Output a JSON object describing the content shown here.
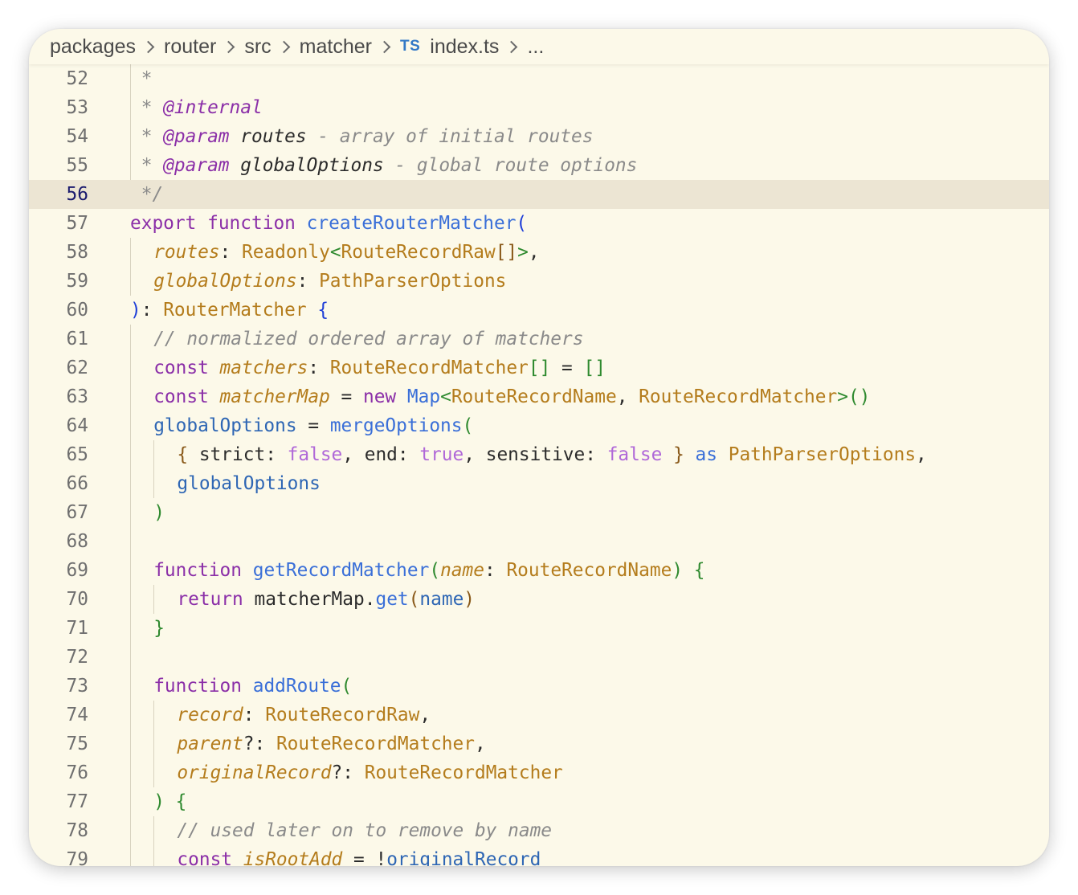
{
  "breadcrumb": {
    "items": [
      "packages",
      "router",
      "src",
      "matcher"
    ],
    "file_icon": "TS",
    "file": "index.ts",
    "more": "..."
  },
  "editor": {
    "current_line": 56,
    "lines": [
      {
        "n": "52",
        "indent": 0,
        "guides": [
          0
        ],
        "tokens": [
          {
            "t": " *",
            "c": "cmt"
          }
        ]
      },
      {
        "n": "53",
        "indent": 0,
        "guides": [
          0
        ],
        "tokens": [
          {
            "t": " * ",
            "c": "cmt"
          },
          {
            "t": "@internal",
            "c": "tag"
          }
        ]
      },
      {
        "n": "54",
        "indent": 0,
        "guides": [
          0
        ],
        "tokens": [
          {
            "t": " * ",
            "c": "cmt"
          },
          {
            "t": "@param",
            "c": "tag"
          },
          {
            "t": " routes",
            "c": "cmtname"
          },
          {
            "t": " - array of initial routes",
            "c": "cmt"
          }
        ]
      },
      {
        "n": "55",
        "indent": 0,
        "guides": [
          0
        ],
        "tokens": [
          {
            "t": " * ",
            "c": "cmt"
          },
          {
            "t": "@param",
            "c": "tag"
          },
          {
            "t": " globalOptions",
            "c": "cmtname"
          },
          {
            "t": " - global route options",
            "c": "cmt"
          }
        ]
      },
      {
        "n": "56",
        "indent": 0,
        "guides": [],
        "tokens": [
          {
            "t": " */",
            "c": "cmt"
          }
        ]
      },
      {
        "n": "57",
        "indent": 0,
        "guides": [],
        "tokens": [
          {
            "t": "export",
            "c": "kw"
          },
          {
            "t": " ",
            "c": "plain"
          },
          {
            "t": "function",
            "c": "kw"
          },
          {
            "t": " ",
            "c": "plain"
          },
          {
            "t": "createRouterMatcher",
            "c": "fn"
          },
          {
            "t": "(",
            "c": "brk1"
          }
        ]
      },
      {
        "n": "58",
        "indent": 1,
        "guides": [
          0
        ],
        "tokens": [
          {
            "t": "routes",
            "c": "param"
          },
          {
            "t": ": ",
            "c": "punc"
          },
          {
            "t": "Readonly",
            "c": "type"
          },
          {
            "t": "<",
            "c": "brk2"
          },
          {
            "t": "RouteRecordRaw",
            "c": "type"
          },
          {
            "t": "[]",
            "c": "brk3"
          },
          {
            "t": ">",
            "c": "brk2"
          },
          {
            "t": ",",
            "c": "punc"
          }
        ]
      },
      {
        "n": "59",
        "indent": 1,
        "guides": [
          0
        ],
        "tokens": [
          {
            "t": "globalOptions",
            "c": "param"
          },
          {
            "t": ": ",
            "c": "punc"
          },
          {
            "t": "PathParserOptions",
            "c": "type"
          }
        ]
      },
      {
        "n": "60",
        "indent": 0,
        "guides": [],
        "tokens": [
          {
            "t": ")",
            "c": "brk1"
          },
          {
            "t": ": ",
            "c": "punc"
          },
          {
            "t": "RouterMatcher",
            "c": "type"
          },
          {
            "t": " ",
            "c": "plain"
          },
          {
            "t": "{",
            "c": "brk1"
          }
        ]
      },
      {
        "n": "61",
        "indent": 1,
        "guides": [
          0
        ],
        "tokens": [
          {
            "t": "// normalized ordered array of matchers",
            "c": "cmt"
          }
        ]
      },
      {
        "n": "62",
        "indent": 1,
        "guides": [
          0
        ],
        "tokens": [
          {
            "t": "const",
            "c": "kw"
          },
          {
            "t": " ",
            "c": "plain"
          },
          {
            "t": "matchers",
            "c": "param"
          },
          {
            "t": ": ",
            "c": "punc"
          },
          {
            "t": "RouteRecordMatcher",
            "c": "type"
          },
          {
            "t": "[]",
            "c": "brk2"
          },
          {
            "t": " = ",
            "c": "punc"
          },
          {
            "t": "[]",
            "c": "brk2"
          }
        ]
      },
      {
        "n": "63",
        "indent": 1,
        "guides": [
          0
        ],
        "tokens": [
          {
            "t": "const",
            "c": "kw"
          },
          {
            "t": " ",
            "c": "plain"
          },
          {
            "t": "matcherMap",
            "c": "param"
          },
          {
            "t": " = ",
            "c": "punc"
          },
          {
            "t": "new",
            "c": "kw"
          },
          {
            "t": " ",
            "c": "plain"
          },
          {
            "t": "Map",
            "c": "fn"
          },
          {
            "t": "<",
            "c": "brk2"
          },
          {
            "t": "RouteRecordName",
            "c": "type"
          },
          {
            "t": ", ",
            "c": "punc"
          },
          {
            "t": "RouteRecordMatcher",
            "c": "type"
          },
          {
            "t": ">",
            "c": "brk2"
          },
          {
            "t": "()",
            "c": "brk2"
          }
        ]
      },
      {
        "n": "64",
        "indent": 1,
        "guides": [
          0
        ],
        "tokens": [
          {
            "t": "globalOptions",
            "c": "var"
          },
          {
            "t": " = ",
            "c": "punc"
          },
          {
            "t": "mergeOptions",
            "c": "fn"
          },
          {
            "t": "(",
            "c": "brk2"
          }
        ]
      },
      {
        "n": "65",
        "indent": 2,
        "guides": [
          0,
          1
        ],
        "tokens": [
          {
            "t": "{",
            "c": "brk3"
          },
          {
            "t": " strict: ",
            "c": "plain"
          },
          {
            "t": "false",
            "c": "bool"
          },
          {
            "t": ", end: ",
            "c": "plain"
          },
          {
            "t": "true",
            "c": "bool"
          },
          {
            "t": ", sensitive: ",
            "c": "plain"
          },
          {
            "t": "false",
            "c": "bool"
          },
          {
            "t": " ",
            "c": "plain"
          },
          {
            "t": "}",
            "c": "brk3"
          },
          {
            "t": " ",
            "c": "plain"
          },
          {
            "t": "as",
            "c": "fn"
          },
          {
            "t": " ",
            "c": "plain"
          },
          {
            "t": "PathParserOptions",
            "c": "type"
          },
          {
            "t": ",",
            "c": "punc"
          }
        ]
      },
      {
        "n": "66",
        "indent": 2,
        "guides": [
          0,
          1
        ],
        "tokens": [
          {
            "t": "globalOptions",
            "c": "var"
          }
        ]
      },
      {
        "n": "67",
        "indent": 1,
        "guides": [
          0
        ],
        "tokens": [
          {
            "t": ")",
            "c": "brk2"
          }
        ]
      },
      {
        "n": "68",
        "indent": 0,
        "guides": [
          0
        ],
        "tokens": []
      },
      {
        "n": "69",
        "indent": 1,
        "guides": [
          0
        ],
        "tokens": [
          {
            "t": "function",
            "c": "kw"
          },
          {
            "t": " ",
            "c": "plain"
          },
          {
            "t": "getRecordMatcher",
            "c": "fn"
          },
          {
            "t": "(",
            "c": "brk2"
          },
          {
            "t": "name",
            "c": "param"
          },
          {
            "t": ": ",
            "c": "punc"
          },
          {
            "t": "RouteRecordName",
            "c": "type"
          },
          {
            "t": ")",
            "c": "brk2"
          },
          {
            "t": " ",
            "c": "plain"
          },
          {
            "t": "{",
            "c": "brk2"
          }
        ]
      },
      {
        "n": "70",
        "indent": 2,
        "guides": [
          0,
          1
        ],
        "tokens": [
          {
            "t": "return",
            "c": "kw"
          },
          {
            "t": " matcherMap",
            "c": "plain"
          },
          {
            "t": ".",
            "c": "punc"
          },
          {
            "t": "get",
            "c": "fn"
          },
          {
            "t": "(",
            "c": "brk3"
          },
          {
            "t": "name",
            "c": "var"
          },
          {
            "t": ")",
            "c": "brk3"
          }
        ]
      },
      {
        "n": "71",
        "indent": 1,
        "guides": [
          0
        ],
        "tokens": [
          {
            "t": "}",
            "c": "brk2"
          }
        ]
      },
      {
        "n": "72",
        "indent": 0,
        "guides": [
          0
        ],
        "tokens": []
      },
      {
        "n": "73",
        "indent": 1,
        "guides": [
          0
        ],
        "tokens": [
          {
            "t": "function",
            "c": "kw"
          },
          {
            "t": " ",
            "c": "plain"
          },
          {
            "t": "addRoute",
            "c": "fn"
          },
          {
            "t": "(",
            "c": "brk2"
          }
        ]
      },
      {
        "n": "74",
        "indent": 2,
        "guides": [
          0,
          1
        ],
        "tokens": [
          {
            "t": "record",
            "c": "param"
          },
          {
            "t": ": ",
            "c": "punc"
          },
          {
            "t": "RouteRecordRaw",
            "c": "type"
          },
          {
            "t": ",",
            "c": "punc"
          }
        ]
      },
      {
        "n": "75",
        "indent": 2,
        "guides": [
          0,
          1
        ],
        "tokens": [
          {
            "t": "parent",
            "c": "param"
          },
          {
            "t": "?: ",
            "c": "punc"
          },
          {
            "t": "RouteRecordMatcher",
            "c": "type"
          },
          {
            "t": ",",
            "c": "punc"
          }
        ]
      },
      {
        "n": "76",
        "indent": 2,
        "guides": [
          0,
          1
        ],
        "tokens": [
          {
            "t": "originalRecord",
            "c": "param"
          },
          {
            "t": "?: ",
            "c": "punc"
          },
          {
            "t": "RouteRecordMatcher",
            "c": "type"
          }
        ]
      },
      {
        "n": "77",
        "indent": 1,
        "guides": [
          0
        ],
        "tokens": [
          {
            "t": ")",
            "c": "brk2"
          },
          {
            "t": " ",
            "c": "plain"
          },
          {
            "t": "{",
            "c": "brk2"
          }
        ]
      },
      {
        "n": "78",
        "indent": 2,
        "guides": [
          0,
          1
        ],
        "tokens": [
          {
            "t": "// used later on to remove by name",
            "c": "cmt"
          }
        ]
      },
      {
        "n": "79",
        "indent": 2,
        "guides": [
          0,
          1
        ],
        "tokens": [
          {
            "t": "const",
            "c": "kw"
          },
          {
            "t": " ",
            "c": "plain"
          },
          {
            "t": "isRootAdd",
            "c": "param"
          },
          {
            "t": " = ",
            "c": "punc"
          },
          {
            "t": "!",
            "c": "punc"
          },
          {
            "t": "originalRecord",
            "c": "var"
          }
        ]
      }
    ]
  }
}
